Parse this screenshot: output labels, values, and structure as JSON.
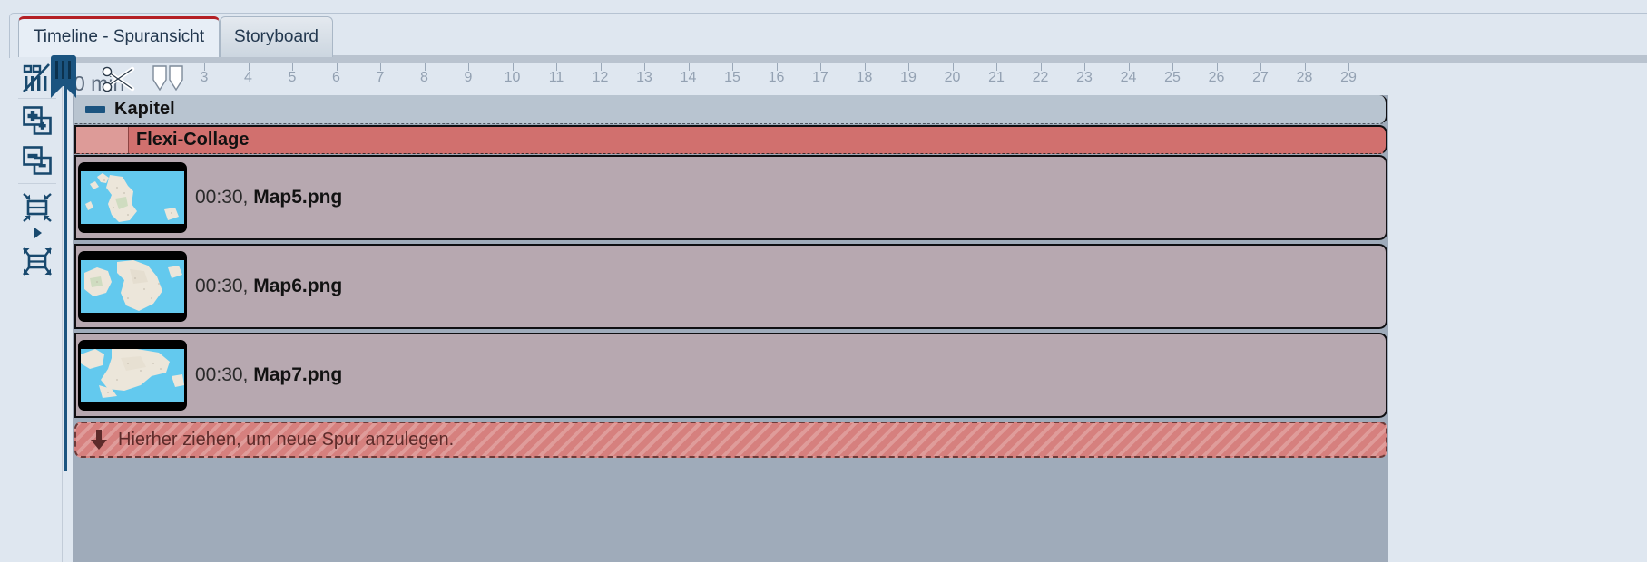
{
  "window": {
    "title": "Timeline - Spuransicht"
  },
  "tabs": [
    {
      "label": "Timeline - Spuransicht",
      "active": true,
      "name": "tab-timeline-spuransicht"
    },
    {
      "label": "Storyboard",
      "active": false,
      "name": "tab-storyboard"
    }
  ],
  "toolbar": {
    "items": [
      {
        "name": "toggle-waveform-icon",
        "label": "Wellenform ein/aus"
      },
      {
        "name": "add-track-icon",
        "label": "Spur hinzufügen"
      },
      {
        "name": "remove-track-icon",
        "label": "Spur entfernen"
      },
      {
        "name": "shrink-tracks-icon",
        "label": "Spurhöhe verkleinern"
      },
      {
        "name": "expand-tracks-icon",
        "label": "Spurhöhe vergrößern"
      }
    ]
  },
  "ruler": {
    "zero_label": "0 min",
    "unit": "min",
    "ticks": [
      3,
      4,
      5,
      6,
      7,
      8,
      9,
      10,
      11,
      12,
      13,
      14,
      15,
      16,
      17,
      18,
      19,
      20,
      21,
      22,
      23,
      24,
      25,
      26,
      27,
      28,
      29
    ],
    "first_tick_x": 225,
    "tick_spacing": 48.5,
    "playhead_position": "0 min",
    "markers": [
      {
        "name": "playhead-marker",
        "type": "playhead"
      },
      {
        "name": "scissors-icon",
        "type": "cut"
      },
      {
        "name": "split-marker-icon",
        "type": "split"
      }
    ]
  },
  "timeline": {
    "chapter": {
      "title": "Kapitel",
      "collapse_label": "−",
      "collapsed": false
    },
    "collage": {
      "title": "Flexi-Collage",
      "collapse_label": "−",
      "collapsed": false
    },
    "clips": [
      {
        "duration": "00:30,",
        "filename": "Map5.png",
        "thumbnail": "map-scotland"
      },
      {
        "duration": "00:30,",
        "filename": "Map6.png",
        "thumbnail": "map-british-isles"
      },
      {
        "duration": "00:30,",
        "filename": "Map7.png",
        "thumbnail": "map-england-wales"
      }
    ],
    "dropzone": {
      "text": "Hierher ziehen, um neue Spur anzulegen.",
      "icon": "arrow-down-icon"
    }
  },
  "colors": {
    "accent_red": "#b42025",
    "chapter_track": "#b8c4d0",
    "collage_track": "#d1706e",
    "clip_track": "#b7a8b0",
    "playhead": "#1b5480",
    "panel_bg": "#dfe7f0",
    "timeline_bg": "#9fabba"
  }
}
